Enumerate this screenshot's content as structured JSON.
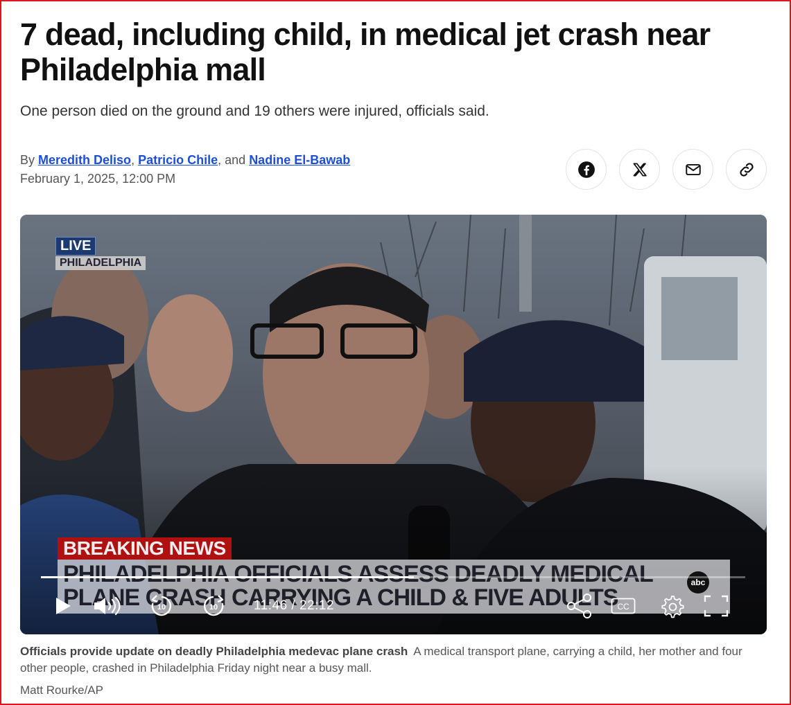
{
  "article": {
    "headline": "7 dead, including child, in medical jet crash near Philadelphia mall",
    "subheadline": "One person died on the ground and 19 others were injured, officials said.",
    "byline": {
      "prefix": "By",
      "authors": [
        "Meredith Deliso",
        "Patricio Chile",
        "Nadine El-Bawab"
      ],
      "sep1": ",",
      "sep2": ", and"
    },
    "date": "February 1, 2025, 12:00 PM"
  },
  "share": {
    "facebook": "facebook-icon",
    "x": "x-icon",
    "email": "mail-icon",
    "link": "link-icon"
  },
  "video": {
    "live_label": "LIVE",
    "location_label": "PHILADELPHIA",
    "breaking_label": "BREAKING NEWS",
    "ticker_line1": "PHILADELPHIA OFFICIALS ASSESS DEADLY MEDICAL",
    "ticker_line2": "PLANE CRASH CARRYING A CHILD & FIVE ADULTS",
    "network_logo": "abc",
    "time_display": "11:46 / 22:12",
    "progress_fraction": 0.53,
    "rewind_label": "10",
    "forward_label": "10",
    "cc_label": "CC"
  },
  "caption": {
    "title": "Officials provide update on deadly Philadelphia medevac plane crash",
    "text": "A medical transport plane, carrying a child, her mother and four other people, crashed in Philadelphia Friday night near a busy mall.",
    "credit": "Matt Rourke/AP"
  },
  "colors": {
    "link": "#1d4ed8",
    "frame": "#e0141e",
    "breaking": "#b01010"
  }
}
